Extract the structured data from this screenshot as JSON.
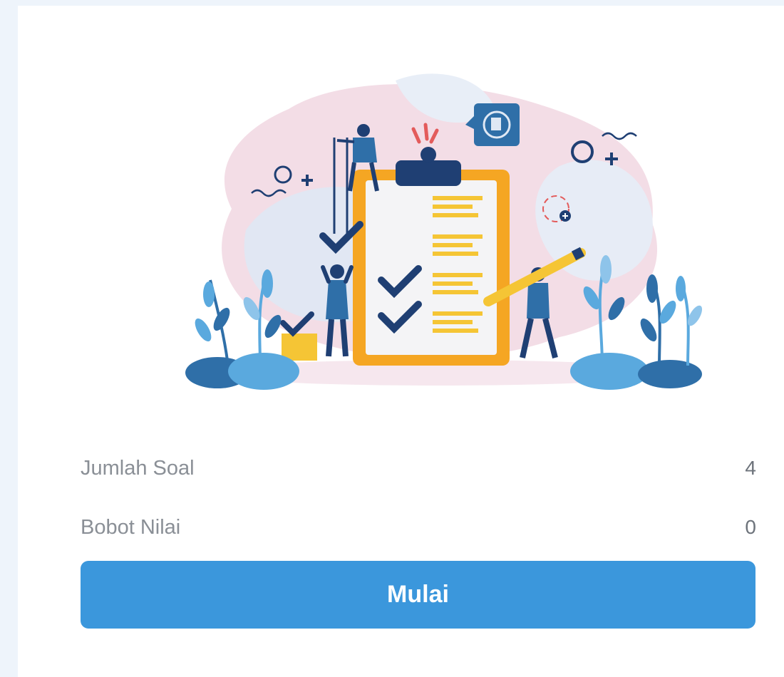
{
  "illustration": {
    "name": "quiz-checklist-illustration",
    "colors": {
      "blob_pink": "#f3dde6",
      "blob_blue": "#dfe8f4",
      "clipboard_frame": "#f5a623",
      "clipboard_paper": "#f4f4f6",
      "navy": "#1f3f73",
      "text_lines": "#f5c535",
      "plant_light": "#5aa9de",
      "plant_dark": "#2f6fa8",
      "accent_red": "#e35b5b"
    }
  },
  "info": {
    "question_count_label": "Jumlah Soal",
    "question_count_value": "4",
    "weight_label": "Bobot Nilai",
    "weight_value": "0"
  },
  "actions": {
    "start_label": "Mulai",
    "start_color": "#3b97dc"
  }
}
